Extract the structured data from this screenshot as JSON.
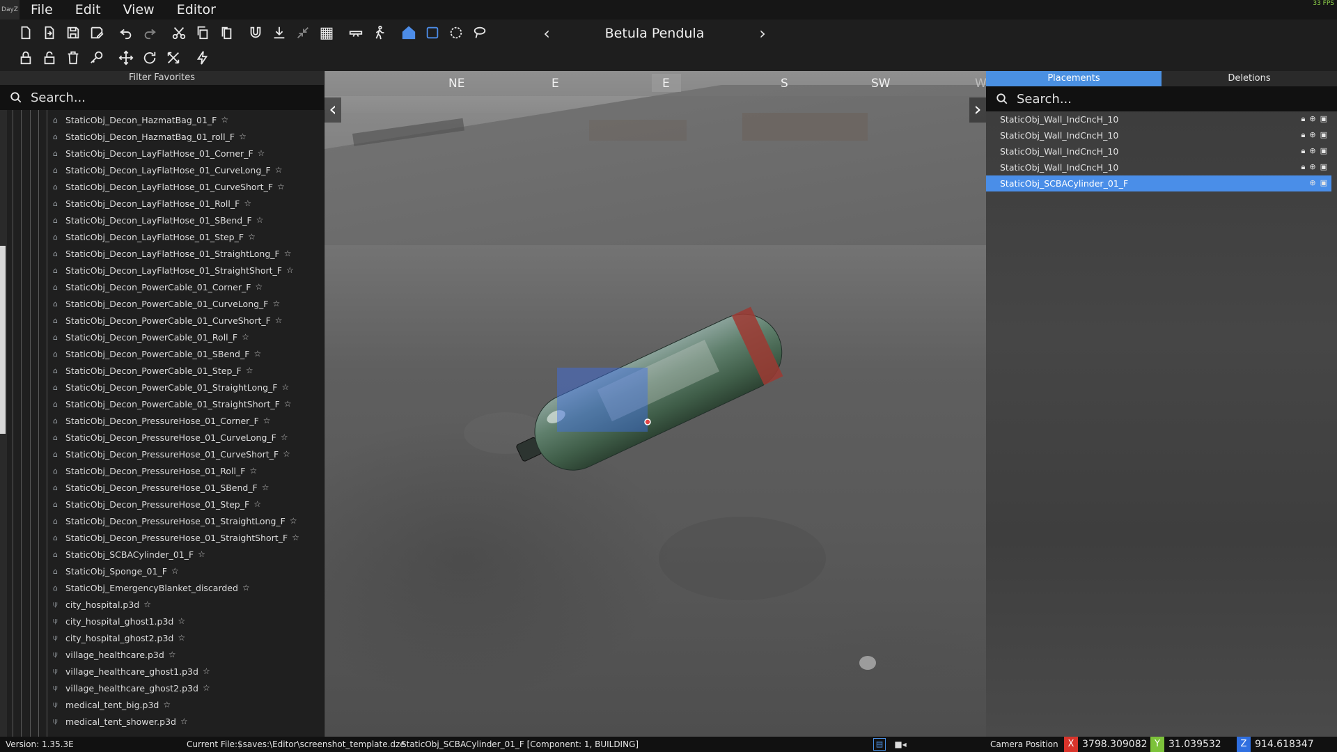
{
  "app": {
    "logo_text": "DayZ",
    "fps": "33 FPS"
  },
  "menu": [
    "File",
    "Edit",
    "View",
    "Editor"
  ],
  "toolbar": {
    "row1": [
      "new-file",
      "open-file",
      "save",
      "save-as",
      "undo",
      "redo",
      "cut",
      "copy",
      "paste",
      "magnet",
      "ground-snap",
      "collapse",
      "grid",
      "binoculars",
      "walk",
      "house",
      "select-rect",
      "select-circle",
      "lasso"
    ],
    "row2": [
      "lock",
      "unlock",
      "delete",
      "key",
      "move",
      "rotate",
      "scale",
      "lightning"
    ]
  },
  "world": {
    "name": "Betula Pendula"
  },
  "left_panel": {
    "filter_label": "Filter Favorites",
    "search_placeholder": "Search...",
    "items": [
      {
        "label": "StaticObj_Decon_HazmatBag_01_F",
        "icon": "house-icon"
      },
      {
        "label": "StaticObj_Decon_HazmatBag_01_roll_F",
        "icon": "house-icon"
      },
      {
        "label": "StaticObj_Decon_LayFlatHose_01_Corner_F",
        "icon": "house-icon"
      },
      {
        "label": "StaticObj_Decon_LayFlatHose_01_CurveLong_F",
        "icon": "house-icon"
      },
      {
        "label": "StaticObj_Decon_LayFlatHose_01_CurveShort_F",
        "icon": "house-icon"
      },
      {
        "label": "StaticObj_Decon_LayFlatHose_01_Roll_F",
        "icon": "house-icon"
      },
      {
        "label": "StaticObj_Decon_LayFlatHose_01_SBend_F",
        "icon": "house-icon"
      },
      {
        "label": "StaticObj_Decon_LayFlatHose_01_Step_F",
        "icon": "house-icon"
      },
      {
        "label": "StaticObj_Decon_LayFlatHose_01_StraightLong_F",
        "icon": "house-icon"
      },
      {
        "label": "StaticObj_Decon_LayFlatHose_01_StraightShort_F",
        "icon": "house-icon"
      },
      {
        "label": "StaticObj_Decon_PowerCable_01_Corner_F",
        "icon": "house-icon"
      },
      {
        "label": "StaticObj_Decon_PowerCable_01_CurveLong_F",
        "icon": "house-icon"
      },
      {
        "label": "StaticObj_Decon_PowerCable_01_CurveShort_F",
        "icon": "house-icon"
      },
      {
        "label": "StaticObj_Decon_PowerCable_01_Roll_F",
        "icon": "house-icon"
      },
      {
        "label": "StaticObj_Decon_PowerCable_01_SBend_F",
        "icon": "house-icon"
      },
      {
        "label": "StaticObj_Decon_PowerCable_01_Step_F",
        "icon": "house-icon"
      },
      {
        "label": "StaticObj_Decon_PowerCable_01_StraightLong_F",
        "icon": "house-icon"
      },
      {
        "label": "StaticObj_Decon_PowerCable_01_StraightShort_F",
        "icon": "house-icon"
      },
      {
        "label": "StaticObj_Decon_PressureHose_01_Corner_F",
        "icon": "house-icon"
      },
      {
        "label": "StaticObj_Decon_PressureHose_01_CurveLong_F",
        "icon": "house-icon"
      },
      {
        "label": "StaticObj_Decon_PressureHose_01_CurveShort_F",
        "icon": "house-icon"
      },
      {
        "label": "StaticObj_Decon_PressureHose_01_Roll_F",
        "icon": "house-icon"
      },
      {
        "label": "StaticObj_Decon_PressureHose_01_SBend_F",
        "icon": "house-icon"
      },
      {
        "label": "StaticObj_Decon_PressureHose_01_Step_F",
        "icon": "house-icon"
      },
      {
        "label": "StaticObj_Decon_PressureHose_01_StraightLong_F",
        "icon": "house-icon"
      },
      {
        "label": "StaticObj_Decon_PressureHose_01_StraightShort_F",
        "icon": "house-icon"
      },
      {
        "label": "StaticObj_SCBACylinder_01_F",
        "icon": "house-icon"
      },
      {
        "label": "StaticObj_Sponge_01_F",
        "icon": "house-icon"
      },
      {
        "label": "StaticObj_EmergencyBlanket_discarded",
        "icon": "house-icon"
      },
      {
        "label": "city_hospital.p3d",
        "icon": "model-icon"
      },
      {
        "label": "city_hospital_ghost1.p3d",
        "icon": "model-icon"
      },
      {
        "label": "city_hospital_ghost2.p3d",
        "icon": "model-icon"
      },
      {
        "label": "village_healthcare.p3d",
        "icon": "model-icon"
      },
      {
        "label": "village_healthcare_ghost1.p3d",
        "icon": "model-icon"
      },
      {
        "label": "village_healthcare_ghost2.p3d",
        "icon": "model-icon"
      },
      {
        "label": "medical_tent_big.p3d",
        "icon": "model-icon"
      },
      {
        "label": "medical_tent_shower.p3d",
        "icon": "model-icon"
      }
    ]
  },
  "viewport": {
    "compass": [
      "NE",
      "E",
      "E",
      "S",
      "SW",
      "W"
    ]
  },
  "right_panel": {
    "tabs": [
      {
        "label": "Placements",
        "active": true
      },
      {
        "label": "Deletions",
        "active": false
      }
    ],
    "search_placeholder": "Search...",
    "items": [
      {
        "label": "StaticObj_Wall_IndCncH_10",
        "locked": true,
        "selected": false
      },
      {
        "label": "StaticObj_Wall_IndCncH_10",
        "locked": true,
        "selected": false
      },
      {
        "label": "StaticObj_Wall_IndCncH_10",
        "locked": true,
        "selected": false
      },
      {
        "label": "StaticObj_Wall_IndCncH_10",
        "locked": true,
        "selected": false
      },
      {
        "label": "StaticObj_SCBACylinder_01_F",
        "locked": false,
        "selected": true
      }
    ]
  },
  "status": {
    "version": "Version: 1.35.3E",
    "current_file": "Current File:$saves:\\Editor\\screenshot_template.dze",
    "selection": "StaticObj_SCBACylinder_01_F [Component: 1, BUILDING]",
    "camera_label": "Camera Position",
    "x_label": "X",
    "x": "3798.309082",
    "y_label": "Y",
    "y": "31.039532",
    "z_label": "Z",
    "z": "914.618347",
    "colors": {
      "x": "#d9342b",
      "y": "#7cc23a",
      "z": "#2f6fe0",
      "accent": "#4a90e2"
    }
  }
}
